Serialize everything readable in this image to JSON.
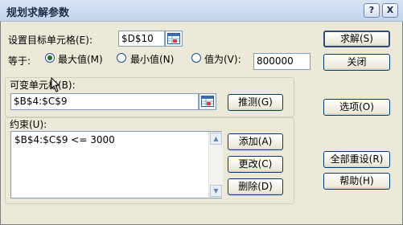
{
  "window": {
    "title": "规划求解参数",
    "help_glyph": "?",
    "close_glyph": "X"
  },
  "target": {
    "label": "设置目标单元格(E):",
    "value": "$D$10"
  },
  "equal_to": {
    "label": "等于:",
    "options": [
      {
        "label": "最大值(M)",
        "selected": true
      },
      {
        "label": "最小值(N)",
        "selected": false
      },
      {
        "label": "值为(V):",
        "selected": false
      }
    ],
    "value": "800000"
  },
  "changing": {
    "label": "可变单元格(B):",
    "value": "$B$4:$C$9",
    "guess_label": "推测(G)"
  },
  "constraints": {
    "label": "约束(U):",
    "items": [
      "$B$4:$C$9 <= 3000"
    ],
    "add_label": "添加(A)",
    "change_label": "更改(C)",
    "delete_label": "删除(D)"
  },
  "buttons": {
    "solve": "求解(S)",
    "close": "关闭",
    "options": "选项(O)",
    "reset_all": "全部重设(R)",
    "help": "帮助(H)"
  },
  "icons": {
    "ref": "range-select-icon",
    "cursor": "mouse-cursor-icon"
  }
}
